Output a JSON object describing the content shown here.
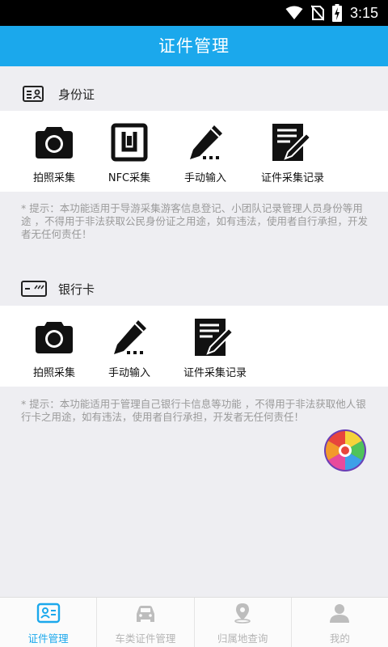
{
  "status_bar": {
    "time": "3:15",
    "icons": [
      "wifi-icon",
      "no-sim-icon",
      "battery-charging-icon"
    ]
  },
  "app_bar": {
    "title": "证件管理"
  },
  "id_card_section": {
    "title": "身份证",
    "icon": "id-card-icon",
    "items": [
      {
        "label": "拍照采集",
        "icon": "camera-icon"
      },
      {
        "label": "NFC采集",
        "icon": "nfc-icon"
      },
      {
        "label": "手动输入",
        "icon": "pen-icon"
      },
      {
        "label": "证件采集记录",
        "icon": "record-icon"
      }
    ],
    "tip": "* 提示：本功能适用于导游采集游客信息登记、小团队记录管理人员身份等用途 ，不得用于非法获取公民身份证之用途，如有违法，使用者自行承担，开发者无任何责任！"
  },
  "bank_card_section": {
    "title": "银行卡",
    "icon": "bank-card-icon",
    "items": [
      {
        "label": "拍照采集",
        "icon": "camera-icon"
      },
      {
        "label": "手动输入",
        "icon": "pen-icon"
      },
      {
        "label": "证件采集记录",
        "icon": "record-icon"
      }
    ],
    "tip": "* 提示：本功能适用于管理自己银行卡信息等功能 ，不得用于非法获取他人银行卡之用途，如有违法，使用者自行承担，开发者无任何责任！"
  },
  "floating_badge": {
    "icon": "lucky-wheel-icon"
  },
  "tab_bar": {
    "tabs": [
      {
        "label": "证件管理",
        "icon": "id-card-tab-icon",
        "active": true
      },
      {
        "label": "车类证件管理",
        "icon": "car-icon",
        "active": false
      },
      {
        "label": "归属地查询",
        "icon": "location-pin-icon",
        "active": false
      },
      {
        "label": "我的",
        "icon": "person-icon",
        "active": false
      }
    ]
  },
  "colors": {
    "primary": "#1ba8ec",
    "background": "#eeeef2",
    "tip_text": "#9a9a9a",
    "tab_inactive": "#b5b5b5"
  }
}
